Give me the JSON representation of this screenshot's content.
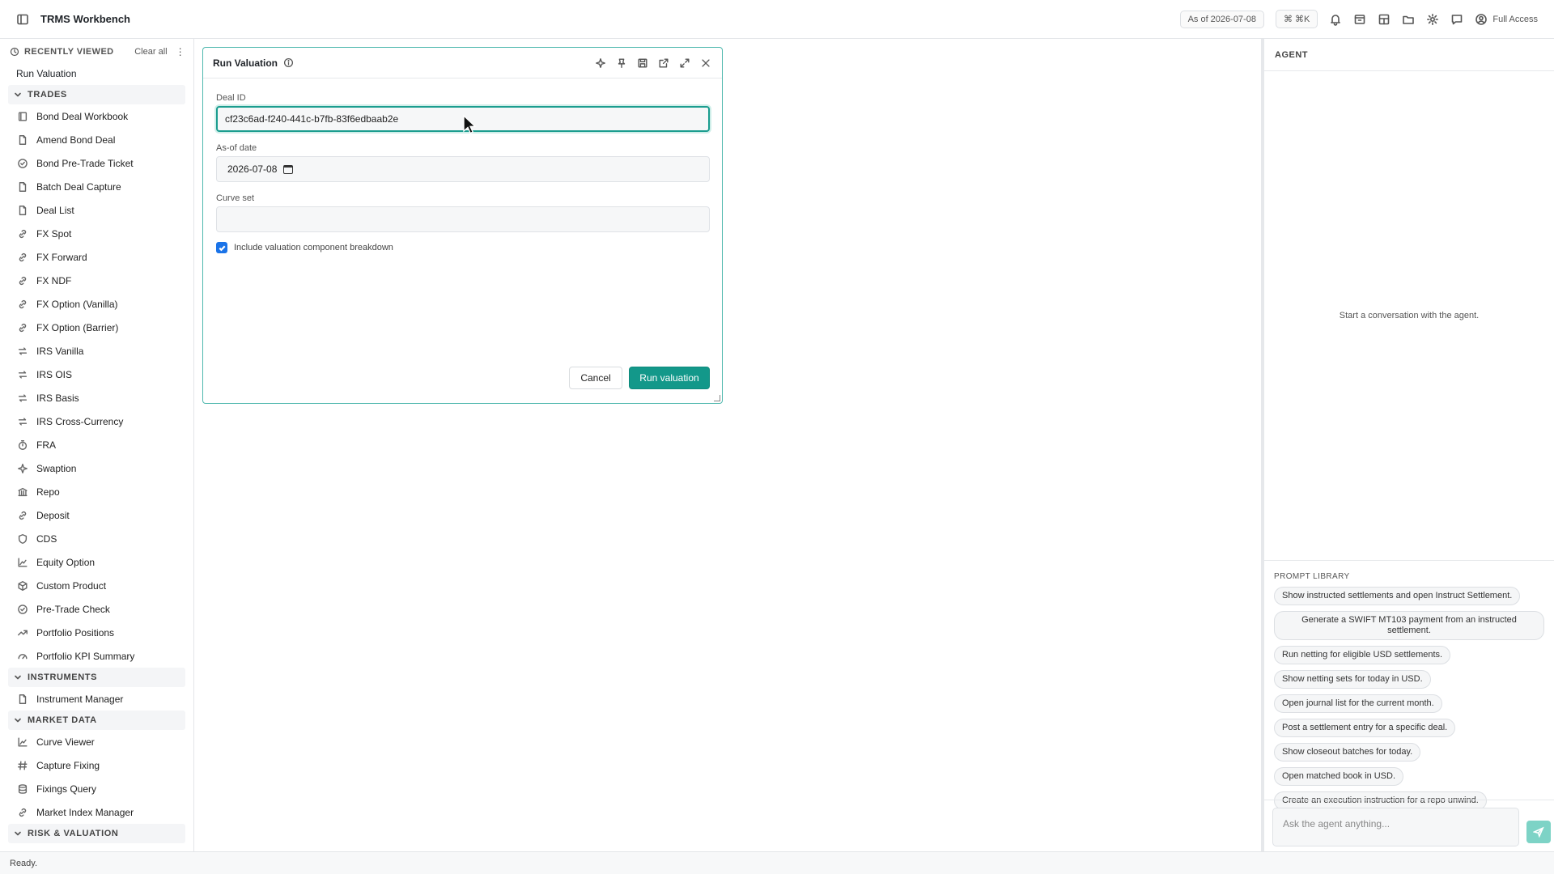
{
  "header": {
    "app_title": "TRMS Workbench",
    "as_of": "As of 2026-07-08",
    "shortcut": "⌘ ⌘K",
    "access": "Full Access"
  },
  "sidebar": {
    "recent_label": "RECENTLY VIEWED",
    "clear_all": "Clear all",
    "recent_items": [
      "Run Valuation"
    ],
    "sections": [
      {
        "label": "TRADES",
        "items": [
          "Bond Deal Workbook",
          "Amend Bond Deal",
          "Bond Pre-Trade Ticket",
          "Batch Deal Capture",
          "Deal List",
          "FX Spot",
          "FX Forward",
          "FX NDF",
          "FX Option (Vanilla)",
          "FX Option (Barrier)",
          "IRS Vanilla",
          "IRS OIS",
          "IRS Basis",
          "IRS Cross-Currency",
          "FRA",
          "Swaption",
          "Repo",
          "Deposit",
          "CDS",
          "Equity Option",
          "Custom Product",
          "Pre-Trade Check",
          "Portfolio Positions",
          "Portfolio KPI Summary"
        ]
      },
      {
        "label": "INSTRUMENTS",
        "items": [
          "Instrument Manager"
        ]
      },
      {
        "label": "MARKET DATA",
        "items": [
          "Curve Viewer",
          "Capture Fixing",
          "Fixings Query",
          "Market Index Manager"
        ]
      },
      {
        "label": "RISK & VALUATION",
        "items": []
      }
    ]
  },
  "dialog": {
    "title": "Run Valuation",
    "deal_id_label": "Deal ID",
    "deal_id_value": "cf23c6ad-f240-441c-b7fb-83f6edbaab2e",
    "asof_label": "As-of date",
    "asof_value": "2026-07-08",
    "curve_label": "Curve set",
    "curve_value": "",
    "checkbox_label": "Include valuation component breakdown",
    "checkbox_checked": true,
    "cancel": "Cancel",
    "run": "Run valuation"
  },
  "agent": {
    "title": "AGENT",
    "empty": "Start a conversation with the agent.",
    "prompt_library_label": "PROMPT LIBRARY",
    "prompts": [
      "Show instructed settlements and open Instruct Settlement.",
      "Generate a SWIFT MT103 payment from an instructed settlement.",
      "Run netting for eligible USD settlements.",
      "Show netting sets for today in USD.",
      "Open journal list for the current month.",
      "Post a settlement entry for a specific deal.",
      "Show closeout batches for today.",
      "Open matched book in USD.",
      "Create an execution instruction for a repo unwind."
    ],
    "input_placeholder": "Ask the agent anything..."
  },
  "status": "Ready."
}
